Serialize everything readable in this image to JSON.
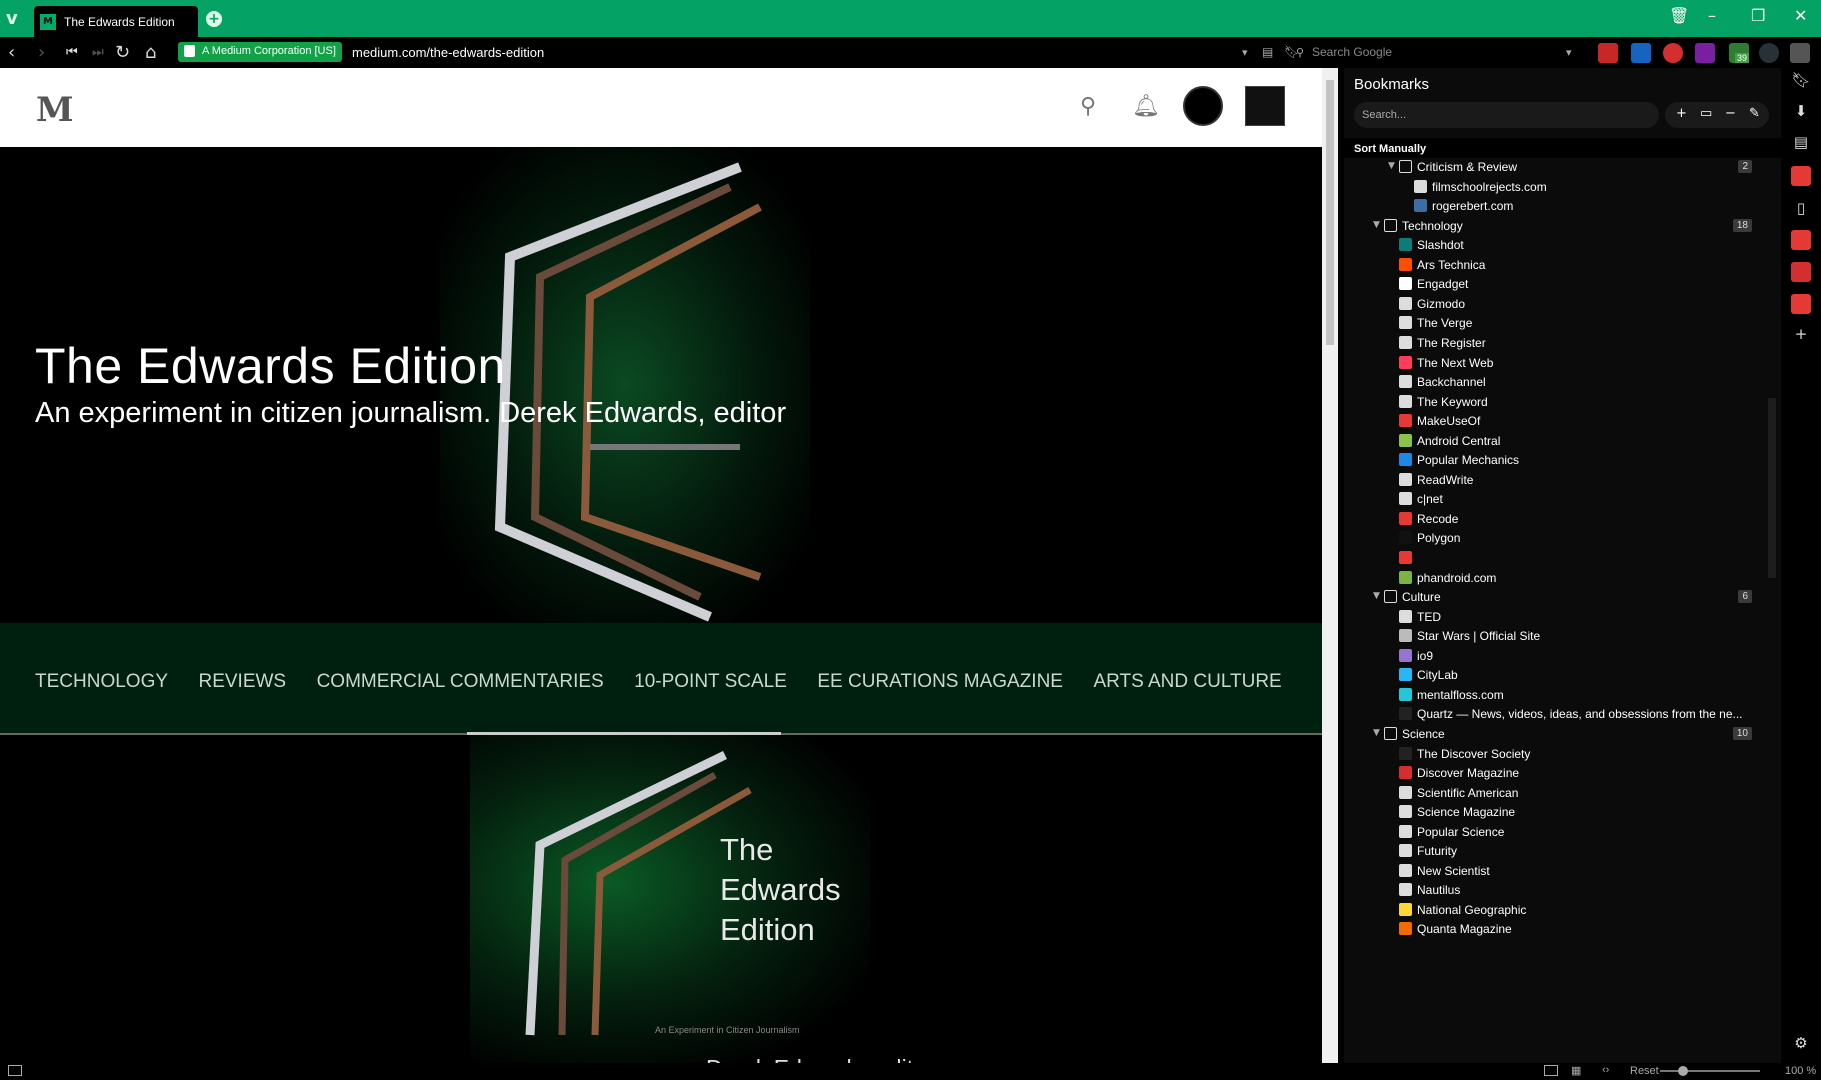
{
  "browser": {
    "tab_title": "The Edwards Edition",
    "cert_label": "A Medium Corporation [US]",
    "url": "medium.com/the-edwards-edition",
    "search_placeholder": "Search Google",
    "extension_badge": "39",
    "zoom": "100 %",
    "zoom_reset": "Reset"
  },
  "hero": {
    "title": "The Edwards Edition",
    "subtitle": "An experiment in citizen journalism. Derek Edwards, editor"
  },
  "nav": [
    "TECHNOLOGY",
    "REVIEWS",
    "COMMERCIAL COMMENTARIES",
    "10-POINT SCALE",
    "EE CURATIONS MAGAZINE",
    "ARTS AND CULTURE"
  ],
  "feature_image": {
    "title_line1": "The",
    "title_line2": "Edwards",
    "title_line3": "Edition",
    "tagline": "An Experiment in Citizen Journalism",
    "editor": "Derek Edwards, editor"
  },
  "bookmarks": {
    "title": "Bookmarks",
    "search_placeholder": "Search...",
    "sort": "Sort Manually",
    "rows": [
      {
        "label": "Criticism & Review",
        "level": 1,
        "type": "folder",
        "count": "2",
        "color": "#dddddd"
      },
      {
        "label": "filmschoolrejects.com",
        "level": 2,
        "type": "doc",
        "color": "#dddddd"
      },
      {
        "label": "rogerebert.com",
        "level": 2,
        "type": "doc",
        "color": "#3a6ea5"
      },
      {
        "label": "Technology",
        "level": 0,
        "type": "folder",
        "count": "18",
        "color": "#dddddd"
      },
      {
        "label": "Slashdot",
        "level": 1,
        "type": "doc",
        "color": "#0f7a7a"
      },
      {
        "label": "Ars Technica",
        "level": 1,
        "type": "doc",
        "color": "#ff4e00"
      },
      {
        "label": "Engadget",
        "level": 1,
        "type": "doc",
        "color": "#ffffff"
      },
      {
        "label": "Gizmodo",
        "level": 1,
        "type": "doc",
        "color": "#dddddd"
      },
      {
        "label": "The Verge",
        "level": 1,
        "type": "doc",
        "color": "#dddddd"
      },
      {
        "label": "The Register",
        "level": 1,
        "type": "doc",
        "color": "#dddddd"
      },
      {
        "label": "The Next Web",
        "level": 1,
        "type": "doc",
        "color": "#ff3c5c"
      },
      {
        "label": "Backchannel",
        "level": 1,
        "type": "doc",
        "color": "#dddddd"
      },
      {
        "label": "The Keyword",
        "level": 1,
        "type": "doc",
        "color": "#dddddd"
      },
      {
        "label": "MakeUseOf",
        "level": 1,
        "type": "doc",
        "color": "#e53935"
      },
      {
        "label": "Android Central",
        "level": 1,
        "type": "doc",
        "color": "#8bc34a"
      },
      {
        "label": "Popular Mechanics",
        "level": 1,
        "type": "doc",
        "color": "#1e88e5"
      },
      {
        "label": "ReadWrite",
        "level": 1,
        "type": "doc",
        "color": "#dddddd"
      },
      {
        "label": "c|net",
        "level": 1,
        "type": "doc",
        "color": "#dddddd"
      },
      {
        "label": "Recode",
        "level": 1,
        "type": "doc",
        "color": "#e53935"
      },
      {
        "label": "Polygon",
        "level": 1,
        "type": "doc",
        "color": "#111111"
      },
      {
        "label": "",
        "level": 1,
        "type": "doc",
        "color": "#e53935"
      },
      {
        "label": "phandroid.com",
        "level": 1,
        "type": "doc",
        "color": "#7cb342"
      },
      {
        "label": "Culture",
        "level": 0,
        "type": "folder",
        "count": "6",
        "color": "#dddddd"
      },
      {
        "label": "TED",
        "level": 1,
        "type": "doc",
        "color": "#dddddd"
      },
      {
        "label": "Star Wars | Official Site",
        "level": 1,
        "type": "doc",
        "color": "#bbbbbb"
      },
      {
        "label": "io9",
        "level": 1,
        "type": "doc",
        "color": "#9575cd"
      },
      {
        "label": "CityLab",
        "level": 1,
        "type": "doc",
        "color": "#29b6f6"
      },
      {
        "label": "mentalfloss.com",
        "level": 1,
        "type": "doc",
        "color": "#26c6da"
      },
      {
        "label": "Quartz — News, videos, ideas, and obsessions from the ne...",
        "level": 1,
        "type": "doc",
        "color": "#222222"
      },
      {
        "label": "Science",
        "level": 0,
        "type": "folder",
        "count": "10",
        "color": "#dddddd"
      },
      {
        "label": "The Discover Society",
        "level": 1,
        "type": "doc",
        "color": "#222222"
      },
      {
        "label": "Discover Magazine",
        "level": 1,
        "type": "doc",
        "color": "#d32f2f"
      },
      {
        "label": "Scientific American",
        "level": 1,
        "type": "doc",
        "color": "#dddddd"
      },
      {
        "label": "Science Magazine",
        "level": 1,
        "type": "doc",
        "color": "#dddddd"
      },
      {
        "label": "Popular Science",
        "level": 1,
        "type": "doc",
        "color": "#dddddd"
      },
      {
        "label": "Futurity",
        "level": 1,
        "type": "doc",
        "color": "#dddddd"
      },
      {
        "label": "New Scientist",
        "level": 1,
        "type": "doc",
        "color": "#dddddd"
      },
      {
        "label": "Nautilus",
        "level": 1,
        "type": "doc",
        "color": "#dddddd"
      },
      {
        "label": "National Geographic",
        "level": 1,
        "type": "doc",
        "color": "#fdd835"
      },
      {
        "label": "Quanta Magazine",
        "level": 1,
        "type": "doc",
        "color": "#ef6c00"
      }
    ]
  },
  "colors": {
    "titlebar": "#04a265",
    "accent_green": "#11a248",
    "nav_strip": "#00200f"
  }
}
